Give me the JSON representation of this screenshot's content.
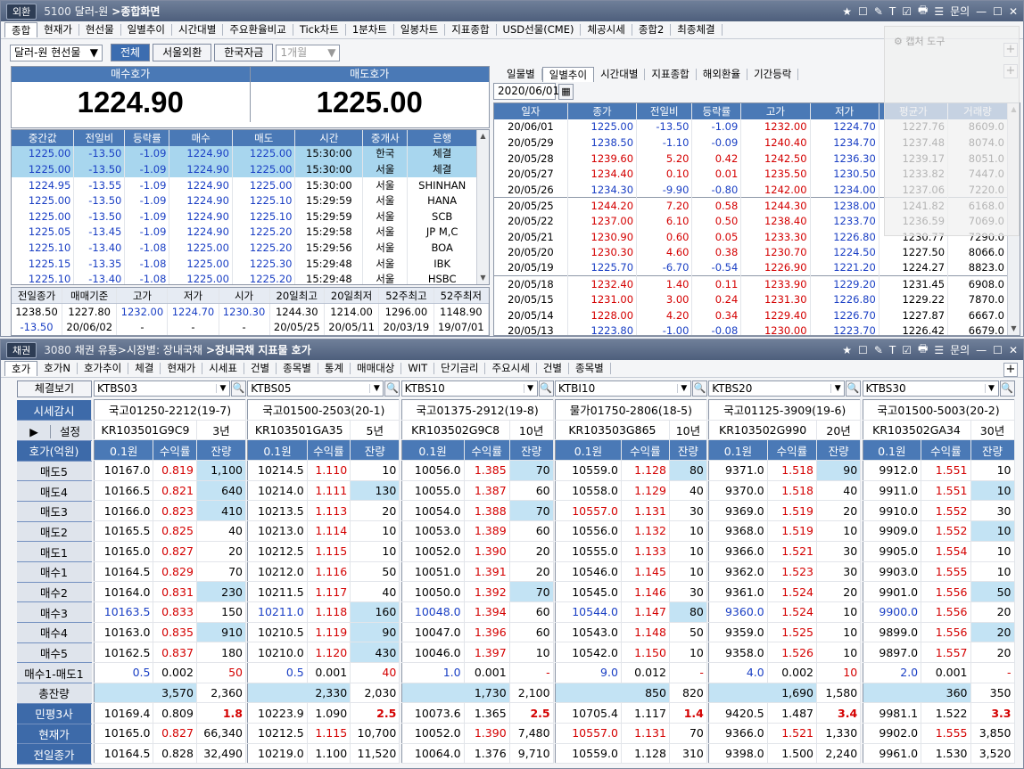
{
  "top": {
    "badge": "외환",
    "window_no": "5100",
    "title": "달러-원",
    "crumb": "종합화면",
    "tools": [
      "★",
      "☐",
      "✎",
      "T",
      "☑",
      "🖶",
      "☰",
      "문의",
      "—",
      "☐",
      "✕"
    ],
    "tabs": [
      "종합",
      "현재가",
      "현선물",
      "일별추이",
      "시간대별",
      "주요환율비교",
      "Tick차트",
      "1분차트",
      "일봉차트",
      "지표종합",
      "USD선물(CME)",
      "체공시세",
      "종합2",
      "최종체결"
    ],
    "market": "달러-원 현선물",
    "filters": [
      "전체",
      "서울외환",
      "한국자금"
    ],
    "period": "1개월",
    "capture": "캡처 도구",
    "bid_label": "매수호가",
    "ask_label": "매도호가",
    "bid": "1224.90",
    "ask": "1225.00",
    "trade_cols": [
      "중간값",
      "전일비",
      "등락률",
      "매수",
      "매도",
      "시간",
      "중개사",
      "은행"
    ],
    "trades": [
      [
        "1225.00",
        "-13.50",
        "-1.09",
        "1224.90",
        "1225.00",
        "15:30:00",
        "한국",
        "체결"
      ],
      [
        "1225.00",
        "-13.50",
        "-1.09",
        "1224.90",
        "1225.00",
        "15:30:00",
        "서울",
        "체결"
      ],
      [
        "1224.95",
        "-13.55",
        "-1.09",
        "1224.90",
        "1225.00",
        "15:30:00",
        "서울",
        "SHINHAN"
      ],
      [
        "1225.00",
        "-13.50",
        "-1.09",
        "1224.90",
        "1225.10",
        "15:29:59",
        "서울",
        "HANA"
      ],
      [
        "1225.00",
        "-13.50",
        "-1.09",
        "1224.90",
        "1225.10",
        "15:29:59",
        "서울",
        "SCB"
      ],
      [
        "1225.05",
        "-13.45",
        "-1.09",
        "1224.90",
        "1225.20",
        "15:29:58",
        "서울",
        "JP M,C"
      ],
      [
        "1225.10",
        "-13.40",
        "-1.08",
        "1225.00",
        "1225.20",
        "15:29:56",
        "서울",
        "BOA"
      ],
      [
        "1225.15",
        "-13.35",
        "-1.08",
        "1225.00",
        "1225.30",
        "15:29:48",
        "서울",
        "IBK"
      ],
      [
        "1225.10",
        "-13.40",
        "-1.08",
        "1225.00",
        "1225.20",
        "15:29:48",
        "서울",
        "HSBC"
      ]
    ],
    "sum_cols": [
      "전일종가",
      "매매기준",
      "고가",
      "저가",
      "시가",
      "20일최고",
      "20일최저",
      "52주최고",
      "52주최저"
    ],
    "sum_row1": [
      "1238.50",
      "1227.80",
      "1232.00",
      "1224.70",
      "1230.30",
      "1244.30",
      "1214.00",
      "1296.00",
      "1148.90"
    ],
    "sum_row2": [
      "-13.50",
      "20/06/02",
      "-",
      "-",
      "-",
      "20/05/25",
      "20/05/11",
      "20/03/19",
      "19/07/01"
    ],
    "right_tabs": [
      "일물별",
      "일별추이",
      "시간대별",
      "지표종합",
      "해외환율",
      "기간등락"
    ],
    "date": "2020/06/01",
    "daily_cols": [
      "일자",
      "종가",
      "전일비",
      "등락률",
      "고가",
      "저가",
      "평균가",
      "거래량"
    ],
    "daily": [
      [
        "20/06/01",
        "1225.00",
        "-13.50",
        "-1.09",
        "1232.00",
        "1224.70",
        "1227.76",
        "8609.0"
      ],
      [
        "20/05/29",
        "1238.50",
        "-1.10",
        "-0.09",
        "1240.40",
        "1234.70",
        "1237.48",
        "8074.0"
      ],
      [
        "20/05/28",
        "1239.60",
        "5.20",
        "0.42",
        "1242.50",
        "1236.30",
        "1239.17",
        "8051.0"
      ],
      [
        "20/05/27",
        "1234.40",
        "0.10",
        "0.01",
        "1235.50",
        "1230.50",
        "1233.82",
        "7447.0"
      ],
      [
        "20/05/26",
        "1234.30",
        "-9.90",
        "-0.80",
        "1242.00",
        "1234.00",
        "1237.06",
        "7220.0"
      ],
      [
        "20/05/25",
        "1244.20",
        "7.20",
        "0.58",
        "1244.30",
        "1238.00",
        "1241.82",
        "6168.0"
      ],
      [
        "20/05/22",
        "1237.00",
        "6.10",
        "0.50",
        "1238.40",
        "1233.70",
        "1236.59",
        "7069.0"
      ],
      [
        "20/05/21",
        "1230.90",
        "0.60",
        "0.05",
        "1233.30",
        "1226.80",
        "1230.77",
        "7290.0"
      ],
      [
        "20/05/20",
        "1230.30",
        "4.60",
        "0.38",
        "1230.70",
        "1224.50",
        "1227.50",
        "8066.0"
      ],
      [
        "20/05/19",
        "1225.70",
        "-6.70",
        "-0.54",
        "1226.90",
        "1221.20",
        "1224.27",
        "8823.0"
      ],
      [
        "20/05/18",
        "1232.40",
        "1.40",
        "0.11",
        "1233.90",
        "1229.20",
        "1231.45",
        "6908.0"
      ],
      [
        "20/05/15",
        "1231.00",
        "3.00",
        "0.24",
        "1231.30",
        "1226.80",
        "1229.22",
        "7870.0"
      ],
      [
        "20/05/14",
        "1228.00",
        "4.20",
        "0.34",
        "1229.40",
        "1226.70",
        "1227.87",
        "6667.0"
      ],
      [
        "20/05/13",
        "1223.80",
        "-1.00",
        "-0.08",
        "1230.00",
        "1223.70",
        "1226.42",
        "6679.0"
      ]
    ]
  },
  "bottom": {
    "badge": "채권",
    "window_no": "3080",
    "path": "채권 유통>시장별: 장내국채",
    "crumb": "장내국채 지표물 호가",
    "tools": [
      "★",
      "☐",
      "✎",
      "T",
      "☑",
      "🖶",
      "☰",
      "문의",
      "—",
      "☐",
      "✕"
    ],
    "tabs": [
      "호가",
      "호가N",
      "호가추이",
      "체결",
      "현재가",
      "시세표",
      "건별",
      "종목별",
      "통계",
      "매매대상",
      "WIT",
      "단기금리",
      "주요시세",
      "건별",
      "종목별"
    ],
    "view_btn": "체결보기",
    "watch_btn": "시세감시",
    "play": "▶",
    "setting": "설정",
    "row_labels": [
      "호가(억원)",
      "매도5",
      "매도4",
      "매도3",
      "매도2",
      "매도1",
      "매수1",
      "매수2",
      "매수3",
      "매수4",
      "매수5",
      "매수1-매도1",
      "총잔량",
      "민평3사",
      "현재가",
      "전일종가"
    ],
    "cols": [
      {
        "code": "KTBS03",
        "name": "국고01250-2212(19-7)",
        "isin": "KR103501G9C9",
        "tenor": "3년",
        "sub": [
          "0.1원",
          "수익률",
          "잔량"
        ],
        "asks": [
          [
            "10167.0",
            "0.819",
            "1,100"
          ],
          [
            "10166.5",
            "0.821",
            "640"
          ],
          [
            "10166.0",
            "0.823",
            "410"
          ],
          [
            "10165.5",
            "0.825",
            "40"
          ],
          [
            "10165.0",
            "0.827",
            "20"
          ]
        ],
        "bids": [
          [
            "10164.5",
            "0.829",
            "70"
          ],
          [
            "10164.0",
            "0.831",
            "230"
          ],
          [
            "10163.5",
            "0.833",
            "150"
          ],
          [
            "10163.0",
            "0.835",
            "910"
          ],
          [
            "10162.5",
            "0.837",
            "180"
          ]
        ],
        "spread": [
          "0.5",
          "0.002",
          "50"
        ],
        "total": [
          "3,570",
          "2,360"
        ],
        "minp": [
          "10169.4",
          "0.809",
          "1.8"
        ],
        "cur": [
          "10165.0",
          "0.827",
          "66,340"
        ],
        "prev": [
          "10164.5",
          "0.828",
          "32,490"
        ]
      },
      {
        "code": "KTBS05",
        "name": "국고01500-2503(20-1)",
        "isin": "KR103501GA35",
        "tenor": "5년",
        "sub": [
          "0.1원",
          "수익률",
          "잔량"
        ],
        "asks": [
          [
            "10214.5",
            "1.110",
            "10"
          ],
          [
            "10214.0",
            "1.111",
            "130"
          ],
          [
            "10213.5",
            "1.113",
            "20"
          ],
          [
            "10213.0",
            "1.114",
            "10"
          ],
          [
            "10212.5",
            "1.115",
            "10"
          ]
        ],
        "bids": [
          [
            "10212.0",
            "1.116",
            "50"
          ],
          [
            "10211.5",
            "1.117",
            "40"
          ],
          [
            "10211.0",
            "1.118",
            "160"
          ],
          [
            "10210.5",
            "1.119",
            "90"
          ],
          [
            "10210.0",
            "1.120",
            "430"
          ]
        ],
        "spread": [
          "0.5",
          "0.001",
          "40"
        ],
        "total": [
          "2,330",
          "2,030"
        ],
        "minp": [
          "10223.9",
          "1.090",
          "2.5"
        ],
        "cur": [
          "10212.5",
          "1.115",
          "10,700"
        ],
        "prev": [
          "10219.0",
          "1.100",
          "11,520"
        ]
      },
      {
        "code": "KTBS10",
        "name": "국고01375-2912(19-8)",
        "isin": "KR103502G9C8",
        "tenor": "10년",
        "sub": [
          "0.1원",
          "수익률",
          "잔량"
        ],
        "asks": [
          [
            "10056.0",
            "1.385",
            "70"
          ],
          [
            "10055.0",
            "1.387",
            "60"
          ],
          [
            "10054.0",
            "1.388",
            "70"
          ],
          [
            "10053.0",
            "1.389",
            "60"
          ],
          [
            "10052.0",
            "1.390",
            "20"
          ]
        ],
        "bids": [
          [
            "10051.0",
            "1.391",
            "20"
          ],
          [
            "10050.0",
            "1.392",
            "70"
          ],
          [
            "10048.0",
            "1.394",
            "60"
          ],
          [
            "10047.0",
            "1.396",
            "60"
          ],
          [
            "10046.0",
            "1.397",
            "10"
          ]
        ],
        "spread": [
          "1.0",
          "0.001",
          "-"
        ],
        "total": [
          "1,730",
          "2,100"
        ],
        "minp": [
          "10073.6",
          "1.365",
          "2.5"
        ],
        "cur": [
          "10052.0",
          "1.390",
          "7,480"
        ],
        "prev": [
          "10064.0",
          "1.376",
          "9,710"
        ]
      },
      {
        "code": "KTBI10",
        "name": "물가01750-2806(18-5)",
        "isin": "KR103503G865",
        "tenor": "10년",
        "sub": [
          "0.1원",
          "수익률",
          "잔량"
        ],
        "asks": [
          [
            "10559.0",
            "1.128",
            "80"
          ],
          [
            "10558.0",
            "1.129",
            "40"
          ],
          [
            "10557.0",
            "1.131",
            "30"
          ],
          [
            "10556.0",
            "1.132",
            "10"
          ],
          [
            "10555.0",
            "1.133",
            "10"
          ]
        ],
        "bids": [
          [
            "10546.0",
            "1.145",
            "10"
          ],
          [
            "10545.0",
            "1.146",
            "30"
          ],
          [
            "10544.0",
            "1.147",
            "80"
          ],
          [
            "10543.0",
            "1.148",
            "50"
          ],
          [
            "10542.0",
            "1.150",
            "10"
          ]
        ],
        "spread": [
          "9.0",
          "0.012",
          "-"
        ],
        "total": [
          "850",
          "820"
        ],
        "minp": [
          "10705.4",
          "1.117",
          "1.4"
        ],
        "cur": [
          "10557.0",
          "1.131",
          "70"
        ],
        "prev": [
          "10559.0",
          "1.128",
          "310"
        ]
      },
      {
        "code": "KTBS20",
        "name": "국고01125-3909(19-6)",
        "isin": "KR103502G990",
        "tenor": "20년",
        "sub": [
          "0.1원",
          "수익률",
          "잔량"
        ],
        "asks": [
          [
            "9371.0",
            "1.518",
            "90"
          ],
          [
            "9370.0",
            "1.518",
            "40"
          ],
          [
            "9369.0",
            "1.519",
            "20"
          ],
          [
            "9368.0",
            "1.519",
            "10"
          ],
          [
            "9366.0",
            "1.521",
            "30"
          ]
        ],
        "bids": [
          [
            "9362.0",
            "1.523",
            "30"
          ],
          [
            "9361.0",
            "1.524",
            "20"
          ],
          [
            "9360.0",
            "1.524",
            "10"
          ],
          [
            "9359.0",
            "1.525",
            "10"
          ],
          [
            "9358.0",
            "1.526",
            "10"
          ]
        ],
        "spread": [
          "4.0",
          "0.002",
          "10"
        ],
        "total": [
          "1,690",
          "1,580"
        ],
        "minp": [
          "9420.5",
          "1.487",
          "3.4"
        ],
        "cur": [
          "9366.0",
          "1.521",
          "1,330"
        ],
        "prev": [
          "9398.0",
          "1.500",
          "2,240"
        ]
      },
      {
        "code": "KTBS30",
        "name": "국고01500-5003(20-2)",
        "isin": "KR103502GA34",
        "tenor": "30년",
        "sub": [
          "0.1원",
          "수익률",
          "잔량"
        ],
        "asks": [
          [
            "9912.0",
            "1.551",
            "10"
          ],
          [
            "9911.0",
            "1.551",
            "10"
          ],
          [
            "9910.0",
            "1.552",
            "30"
          ],
          [
            "9909.0",
            "1.552",
            "10"
          ],
          [
            "9905.0",
            "1.554",
            "10"
          ]
        ],
        "bids": [
          [
            "9903.0",
            "1.555",
            "10"
          ],
          [
            "9901.0",
            "1.556",
            "50"
          ],
          [
            "9900.0",
            "1.556",
            "20"
          ],
          [
            "9899.0",
            "1.556",
            "20"
          ],
          [
            "9897.0",
            "1.557",
            "20"
          ]
        ],
        "spread": [
          "2.0",
          "0.001",
          "-"
        ],
        "total": [
          "360",
          "350"
        ],
        "minp": [
          "9981.1",
          "1.522",
          "3.3"
        ],
        "cur": [
          "9902.0",
          "1.555",
          "3,850"
        ],
        "prev": [
          "9961.0",
          "1.530",
          "3,520"
        ]
      }
    ]
  }
}
